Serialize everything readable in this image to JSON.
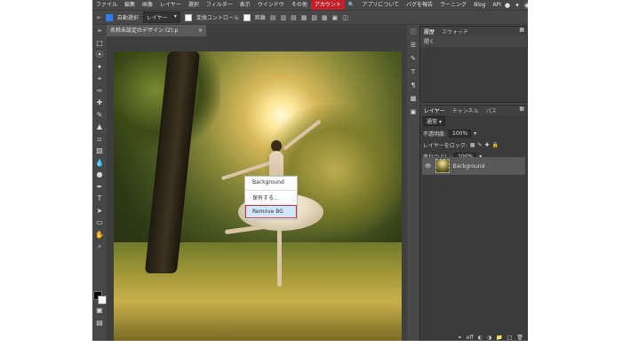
{
  "menu": {
    "items": [
      "ファイル",
      "編集",
      "画像",
      "レイヤー",
      "選択",
      "フィルター",
      "表示",
      "ウインドウ",
      "その他",
      "アカウント",
      "アプリについて",
      "バグを報告",
      "ラーニング",
      "Blog",
      "API"
    ],
    "active": "アカウント",
    "accent_color": "#c8202a"
  },
  "options": {
    "auto_select_label": "自動選択",
    "auto_select_checked": true,
    "target_select": "レイヤー",
    "transform_label": "変換コントロール",
    "distance_label": "距離"
  },
  "document": {
    "tab_title": "名称未設定のデザイン (2).p",
    "close_symbol": "×"
  },
  "context_menu": {
    "items": [
      "Background",
      "保有する…",
      "Remove BG"
    ],
    "highlighted": "Remove BG",
    "highlight_border_color": "#d22b2b"
  },
  "history_panel": {
    "tabs": [
      "履歴",
      "スウォッチ"
    ],
    "active_tab": "履歴",
    "entries": [
      "開く"
    ]
  },
  "layers_panel": {
    "tabs": [
      "レイヤー",
      "チャンネル",
      "パス"
    ],
    "active_tab": "レイヤー",
    "blend_mode": "通常",
    "opacity_label": "不透明度:",
    "opacity_value": "100%",
    "lock_label": "レイヤーをロック:",
    "fill_label": "塗りつぶし:",
    "fill_value": "100%",
    "layers": [
      {
        "name": "Background",
        "visible": true,
        "selected": true
      }
    ]
  }
}
